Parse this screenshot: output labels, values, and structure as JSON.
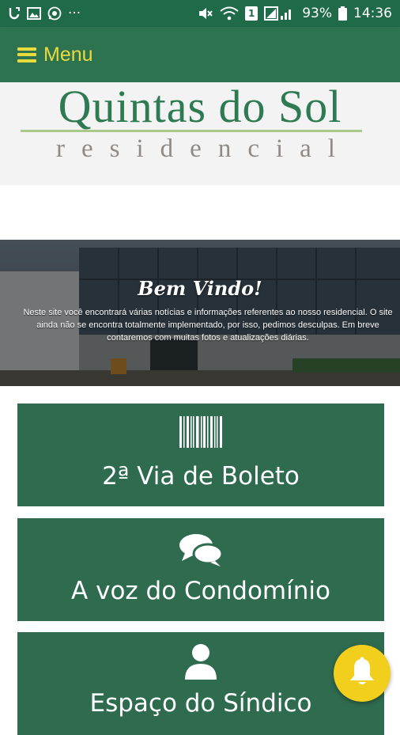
{
  "status_bar": {
    "icons_left": [
      "data-usage-icon",
      "image-icon",
      "whatsapp-icon",
      "more-dots-icon"
    ],
    "icons_right": [
      "mute-icon",
      "wifi-icon",
      "sim-1-icon",
      "signal-icon"
    ],
    "more_dots": "···",
    "sim_label": "1",
    "battery_percent": "93%",
    "time": "14:36"
  },
  "menu": {
    "label": "Menu"
  },
  "logo": {
    "title": "Quintas do Sol",
    "subtitle": "residencial"
  },
  "hero": {
    "title": "Bem Vindo!",
    "text": "Neste site você encontrará várias notícias e informações referentes ao nosso residencial. O site ainda não se encontra totalmente implementado, por isso, pedimos desculpas. Em breve contaremos com muitas fotos e atualizações diárias."
  },
  "actions": [
    {
      "label": "2ª Via de Boleto",
      "icon": "barcode-icon"
    },
    {
      "label": "A voz do Condomínio",
      "icon": "comments-icon"
    },
    {
      "label": "Espaço do Síndico",
      "icon": "user-icon"
    }
  ],
  "notification_button": {
    "icon": "bell-icon"
  },
  "colors": {
    "status_bar": "#1f6a48",
    "menu_bar": "#2d7350",
    "menu_text": "#e9da3e",
    "card": "#2f6b4f",
    "logo_green": "#2e7a52",
    "logo_gray": "#8f8a85",
    "bell_button": "#f2cf1d"
  }
}
